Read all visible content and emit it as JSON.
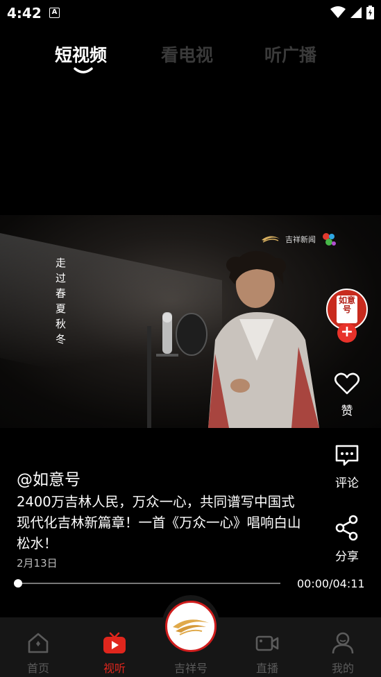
{
  "status_bar": {
    "time": "4:42",
    "notification_letter": "A",
    "icons": [
      "wifi-icon",
      "signal-icon",
      "battery-icon"
    ]
  },
  "top_tabs": [
    {
      "label": "短视频",
      "active": true
    },
    {
      "label": "看电视",
      "active": false
    },
    {
      "label": "听广播",
      "active": false
    }
  ],
  "video": {
    "overlay_vertical_text": "走过春夏秋冬",
    "watermark_text": "吉祥新闻",
    "watermark_mark": "吉祥新闻"
  },
  "actions": {
    "avatar_text": "如意号",
    "like_label": "赞",
    "comment_label": "评论",
    "share_label": "分享"
  },
  "post": {
    "author": "@如意号",
    "caption": "2400万吉林人民，万众一心，共同谱写中国式现代化吉林新篇章！一首《万众一心》唱响白山松水！",
    "date": "2月13日"
  },
  "player": {
    "time": "00:00/04:11",
    "progress": 0
  },
  "bottom_nav": [
    {
      "label": "首页",
      "icon": "home-icon",
      "active": false
    },
    {
      "label": "视听",
      "icon": "play-tv-icon",
      "active": true
    },
    {
      "label": "吉祥号",
      "icon": "jixiang-logo-icon",
      "active": false
    },
    {
      "label": "直播",
      "icon": "video-camera-icon",
      "active": false
    },
    {
      "label": "我的",
      "icon": "user-icon",
      "active": false
    }
  ],
  "colors": {
    "accent": "#e0261d",
    "inactive": "#5b5b5b",
    "nav_bg": "#161616"
  }
}
